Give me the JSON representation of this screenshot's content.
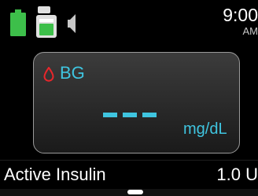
{
  "status_bar": {
    "battery_icon": "battery-icon",
    "cartridge_icon": "insulin-cartridge-icon",
    "sound_icon": "speaker-icon",
    "time": "9:00",
    "ampm": "AM"
  },
  "bg_card": {
    "icon": "blood-drop-icon",
    "label": "BG",
    "value": "---",
    "unit": "mg/dL"
  },
  "active_insulin": {
    "label": "Active Insulin",
    "value": "1.0 U"
  },
  "colors": {
    "accent": "#3fc5e0",
    "battery": "#3dbf4a",
    "drop": "#e8262b",
    "background": "#000000"
  }
}
